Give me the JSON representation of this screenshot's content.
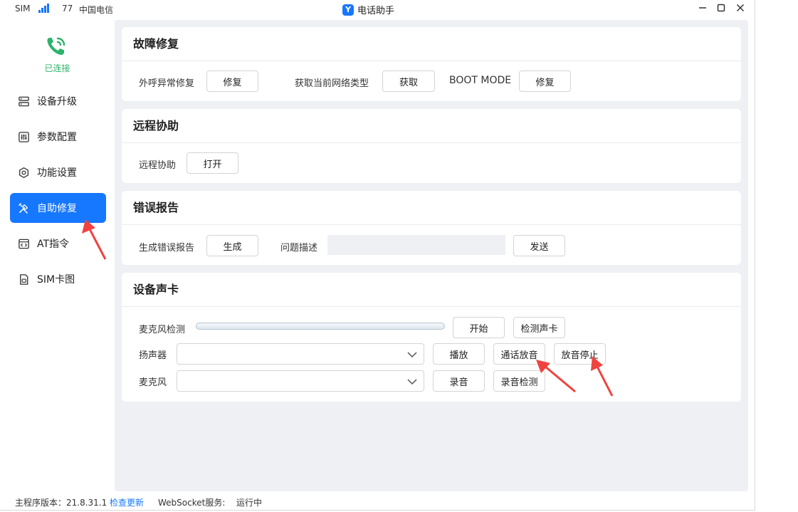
{
  "titlebar": {
    "sim_label": "SIM",
    "signal_strength": "77",
    "carrier": "中国电信",
    "app_title": "电话助手",
    "app_logo_letter": "Y"
  },
  "sidebar": {
    "status_text": "已连接",
    "items": [
      {
        "label": "设备升级",
        "icon": "server-icon",
        "active": false
      },
      {
        "label": "参数配置",
        "icon": "sliders-icon",
        "active": false
      },
      {
        "label": "功能设置",
        "icon": "gear-icon",
        "active": false
      },
      {
        "label": "自助修复",
        "icon": "tools-icon",
        "active": true
      },
      {
        "label": "AT指令",
        "icon": "code-icon",
        "active": false
      },
      {
        "label": "SIM卡图",
        "icon": "sim-card-icon",
        "active": false
      }
    ]
  },
  "fault_repair": {
    "title": "故障修复",
    "call_fix_label": "外呼异常修复",
    "call_fix_button": "修复",
    "network_label": "获取当前网络类型",
    "network_button": "获取",
    "boot_label": "BOOT MODE",
    "boot_button": "修复"
  },
  "remote": {
    "title": "远程协助",
    "label": "远程协助",
    "button": "打开"
  },
  "error_report": {
    "title": "错误报告",
    "generate_label": "生成错误报告",
    "generate_button": "生成",
    "desc_label": "问题描述",
    "desc_value": "",
    "send_button": "发送"
  },
  "sound_card": {
    "title": "设备声卡",
    "mic_test_label": "麦克风检测",
    "start_button": "开始",
    "detect_button": "检测声卡",
    "speaker_label": "扬声器",
    "speaker_value": "",
    "play_button": "播放",
    "call_play_button": "通话放音",
    "stop_play_button": "放音停止",
    "mic_label": "麦克风",
    "mic_value": "",
    "record_button": "录音",
    "record_test_button": "录音检测"
  },
  "footer": {
    "version_label": "主程序版本：21.8.31.1",
    "update_link": "检查更新",
    "ws_label": "WebSocket服务:",
    "ws_status": "运行中"
  },
  "colors": {
    "accent": "#1677ff",
    "connected": "#2db36b",
    "annotation": "#f0433f"
  }
}
